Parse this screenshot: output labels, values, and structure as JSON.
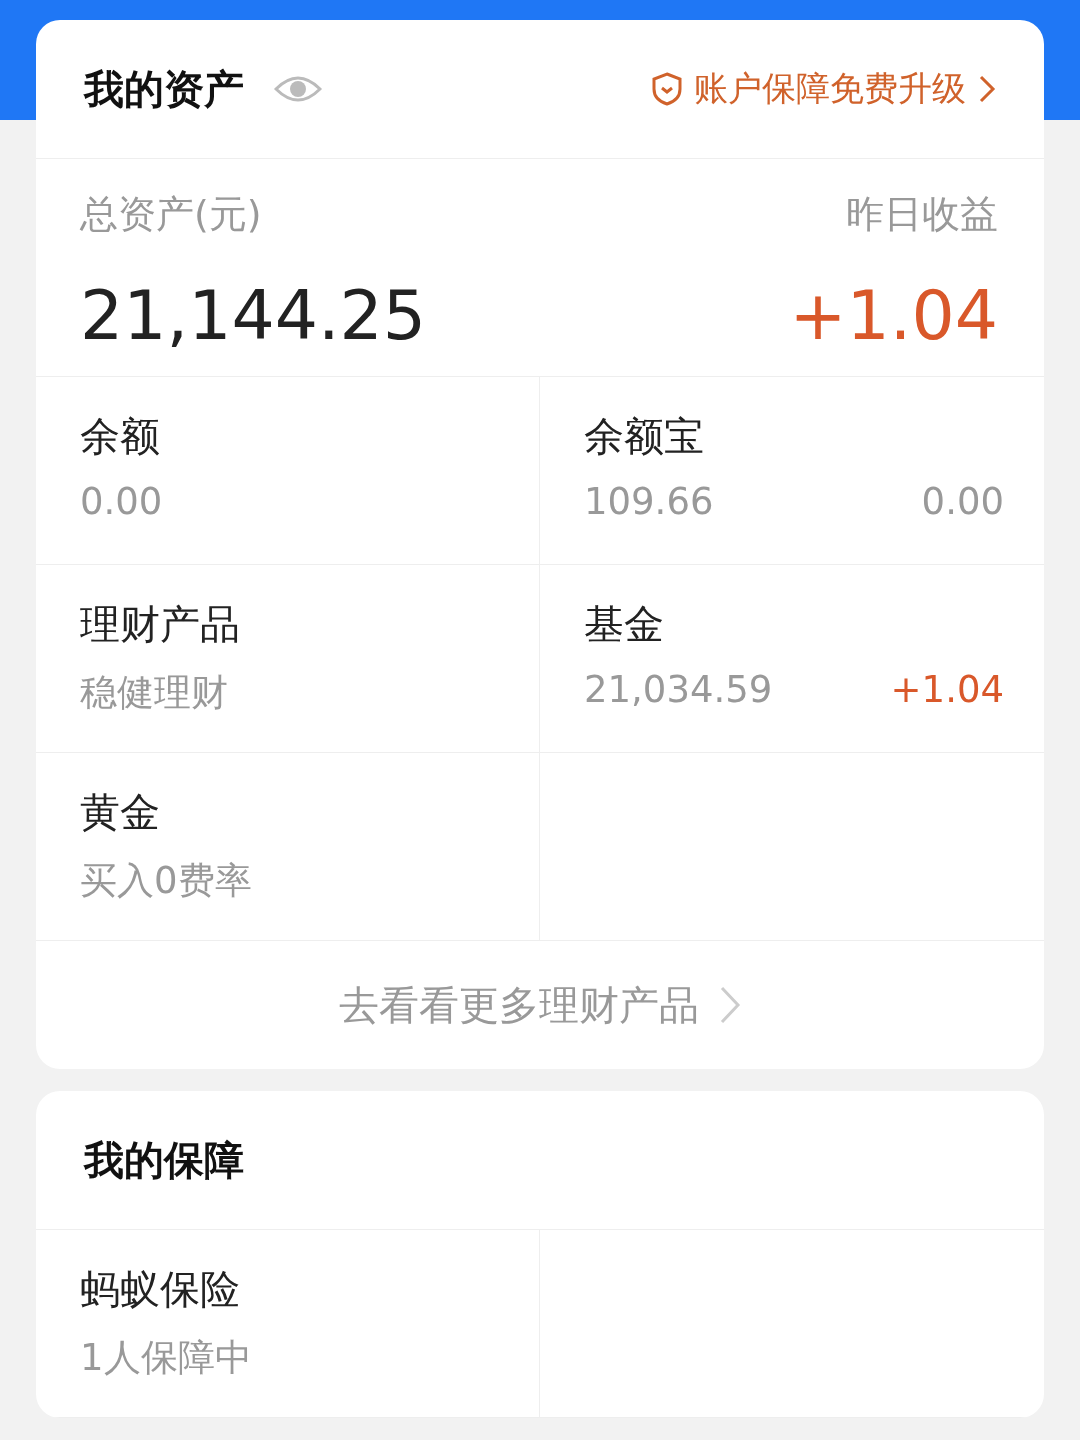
{
  "assets": {
    "title": "我的资产",
    "upgrade_link": "账户保障免费升级",
    "summary": {
      "total_label": "总资产(元)",
      "total": "21,144.25",
      "yesterday_label": "昨日收益",
      "yesterday": "+1.04"
    },
    "cells": [
      {
        "title": "余额",
        "subtitle": "0.00"
      },
      {
        "title": "余额宝",
        "subtitle": "109.66",
        "value": "0.00",
        "kind": "plain"
      },
      {
        "title": "理财产品",
        "subtitle": "稳健理财"
      },
      {
        "title": "基金",
        "subtitle": "21,034.59",
        "value": "+1.04",
        "kind": "gain"
      },
      {
        "title": "黄金",
        "subtitle": "买入0费率"
      }
    ],
    "more_link": "去看看更多理财产品"
  },
  "protection": {
    "title": "我的保障",
    "cells": [
      {
        "title": "蚂蚁保险",
        "subtitle": "1人保障中"
      }
    ]
  }
}
